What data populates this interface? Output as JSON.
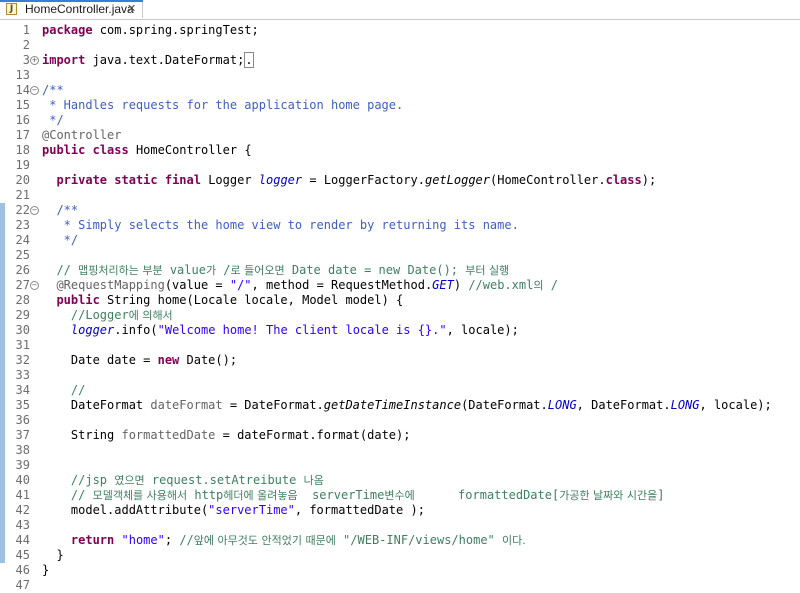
{
  "tab": {
    "filename": "HomeController.java",
    "close": "✕",
    "icon": "J"
  },
  "lines": [
    {
      "n": "1",
      "segs": [
        {
          "c": "kw",
          "t": "package"
        },
        {
          "c": "",
          "t": " com.spring.springTest;"
        }
      ]
    },
    {
      "n": "2",
      "segs": []
    },
    {
      "n": "3",
      "fold": "+",
      "segs": [
        {
          "c": "kw",
          "t": "import"
        },
        {
          "c": "",
          "t": " java.text.DateFormat;"
        },
        {
          "c": "box",
          "t": "."
        }
      ]
    },
    {
      "n": "13",
      "segs": []
    },
    {
      "n": "14",
      "fold": "-",
      "segs": [
        {
          "c": "jd",
          "t": "/**"
        }
      ]
    },
    {
      "n": "15",
      "segs": [
        {
          "c": "jd",
          "t": " * Handles requests for the application home page."
        }
      ]
    },
    {
      "n": "16",
      "segs": [
        {
          "c": "jd",
          "t": " */"
        }
      ]
    },
    {
      "n": "17",
      "segs": [
        {
          "c": "an",
          "t": "@Controller"
        }
      ]
    },
    {
      "n": "18",
      "segs": [
        {
          "c": "kw",
          "t": "public"
        },
        {
          "c": "",
          "t": " "
        },
        {
          "c": "kw",
          "t": "class"
        },
        {
          "c": "",
          "t": " HomeController {"
        }
      ]
    },
    {
      "n": "19",
      "segs": []
    },
    {
      "n": "20",
      "segs": [
        {
          "c": "",
          "t": "  "
        },
        {
          "c": "kw",
          "t": "private"
        },
        {
          "c": "",
          "t": " "
        },
        {
          "c": "kw",
          "t": "static"
        },
        {
          "c": "",
          "t": " "
        },
        {
          "c": "kw",
          "t": "final"
        },
        {
          "c": "",
          "t": " Logger "
        },
        {
          "c": "fi",
          "t": "logger"
        },
        {
          "c": "",
          "t": " = LoggerFactory."
        },
        {
          "c": "it",
          "t": "getLogger"
        },
        {
          "c": "",
          "t": "(HomeController."
        },
        {
          "c": "kw",
          "t": "class"
        },
        {
          "c": "",
          "t": ");"
        }
      ]
    },
    {
      "n": "21",
      "segs": []
    },
    {
      "n": "22",
      "fold": "-",
      "chg": true,
      "segs": [
        {
          "c": "",
          "t": "  "
        },
        {
          "c": "jd",
          "t": "/**"
        }
      ]
    },
    {
      "n": "23",
      "chg": true,
      "segs": [
        {
          "c": "jd",
          "t": "   * Simply selects the home view to render by returning its name."
        }
      ]
    },
    {
      "n": "24",
      "chg": true,
      "segs": [
        {
          "c": "jd",
          "t": "   */"
        }
      ]
    },
    {
      "n": "25",
      "chg": true,
      "segs": []
    },
    {
      "n": "26",
      "chg": true,
      "segs": [
        {
          "c": "cm",
          "t": "  // "
        },
        {
          "c": "cm kr",
          "t": "맵핑처리하는 부분"
        },
        {
          "c": "cm",
          "t": " value"
        },
        {
          "c": "cm kr",
          "t": "가"
        },
        {
          "c": "cm",
          "t": " /"
        },
        {
          "c": "cm kr",
          "t": "로 들어오면"
        },
        {
          "c": "cm",
          "t": " Date date = new Date(); "
        },
        {
          "c": "cm kr",
          "t": "부터 실행"
        }
      ]
    },
    {
      "n": "27",
      "fold": "-",
      "chg": true,
      "segs": [
        {
          "c": "",
          "t": "  "
        },
        {
          "c": "an",
          "t": "@RequestMapping"
        },
        {
          "c": "",
          "t": "(value = "
        },
        {
          "c": "st",
          "t": "\"/\""
        },
        {
          "c": "",
          "t": ", method = RequestMethod."
        },
        {
          "c": "fi",
          "t": "GET"
        },
        {
          "c": "",
          "t": ") "
        },
        {
          "c": "cm",
          "t": "//web.xml"
        },
        {
          "c": "cm kr",
          "t": "의"
        },
        {
          "c": "cm",
          "t": " /"
        }
      ]
    },
    {
      "n": "28",
      "chg": true,
      "segs": [
        {
          "c": "",
          "t": "  "
        },
        {
          "c": "kw",
          "t": "public"
        },
        {
          "c": "",
          "t": " String home(Locale locale, Model model) {"
        }
      ]
    },
    {
      "n": "29",
      "chg": true,
      "segs": [
        {
          "c": "cm",
          "t": "    //Logger"
        },
        {
          "c": "cm kr",
          "t": "에 의해서"
        }
      ]
    },
    {
      "n": "30",
      "chg": true,
      "segs": [
        {
          "c": "",
          "t": "    "
        },
        {
          "c": "fi",
          "t": "logger"
        },
        {
          "c": "",
          "t": ".info("
        },
        {
          "c": "st",
          "t": "\"Welcome home! The client locale is {}.\""
        },
        {
          "c": "",
          "t": ", locale);"
        }
      ]
    },
    {
      "n": "31",
      "chg": true,
      "segs": []
    },
    {
      "n": "32",
      "chg": true,
      "segs": [
        {
          "c": "",
          "t": "    Date date = "
        },
        {
          "c": "kw",
          "t": "new"
        },
        {
          "c": "",
          "t": " Date();"
        }
      ]
    },
    {
      "n": "33",
      "chg": true,
      "segs": []
    },
    {
      "n": "34",
      "chg": true,
      "segs": [
        {
          "c": "cm",
          "t": "    //"
        }
      ]
    },
    {
      "n": "35",
      "chg": true,
      "segs": [
        {
          "c": "",
          "t": "    DateFormat "
        },
        {
          "c": "an",
          "t": "dateFormat"
        },
        {
          "c": "",
          "t": " = DateFormat."
        },
        {
          "c": "it",
          "t": "getDateTimeInstance"
        },
        {
          "c": "",
          "t": "(DateFormat."
        },
        {
          "c": "fi",
          "t": "LONG"
        },
        {
          "c": "",
          "t": ", DateFormat."
        },
        {
          "c": "fi",
          "t": "LONG"
        },
        {
          "c": "",
          "t": ", locale);"
        }
      ]
    },
    {
      "n": "36",
      "chg": true,
      "segs": []
    },
    {
      "n": "37",
      "chg": true,
      "segs": [
        {
          "c": "",
          "t": "    String "
        },
        {
          "c": "an",
          "t": "formattedDate"
        },
        {
          "c": "",
          "t": " = dateFormat.format(date);"
        }
      ]
    },
    {
      "n": "38",
      "chg": true,
      "segs": []
    },
    {
      "n": "39",
      "chg": true,
      "segs": []
    },
    {
      "n": "40",
      "chg": true,
      "segs": [
        {
          "c": "cm",
          "t": "    //jsp "
        },
        {
          "c": "cm kr",
          "t": "였으면"
        },
        {
          "c": "cm",
          "t": " request.setAtreibute "
        },
        {
          "c": "cm kr",
          "t": "나옴"
        }
      ]
    },
    {
      "n": "41",
      "chg": true,
      "segs": [
        {
          "c": "cm",
          "t": "    // "
        },
        {
          "c": "cm kr",
          "t": "모델객체를 사용해서"
        },
        {
          "c": "cm",
          "t": " http"
        },
        {
          "c": "cm kr",
          "t": "헤더에 올려놓음"
        },
        {
          "c": "cm",
          "t": "  serverTime"
        },
        {
          "c": "cm kr",
          "t": "변수에"
        },
        {
          "c": "cm",
          "t": "      formattedDate["
        },
        {
          "c": "cm kr",
          "t": "가공한 날짜와 시간을"
        },
        {
          "c": "cm",
          "t": "]"
        }
      ]
    },
    {
      "n": "42",
      "chg": true,
      "segs": [
        {
          "c": "",
          "t": "    model.addAttribute("
        },
        {
          "c": "st",
          "t": "\"serverTime\""
        },
        {
          "c": "",
          "t": ", formattedDate );"
        }
      ]
    },
    {
      "n": "43",
      "chg": true,
      "segs": []
    },
    {
      "n": "44",
      "chg": true,
      "segs": [
        {
          "c": "",
          "t": "    "
        },
        {
          "c": "kw",
          "t": "return"
        },
        {
          "c": "",
          "t": " "
        },
        {
          "c": "st",
          "t": "\"home\""
        },
        {
          "c": "",
          "t": "; "
        },
        {
          "c": "cm",
          "t": "//"
        },
        {
          "c": "cm kr",
          "t": "앞에 아무것도 안적었기 때문에"
        },
        {
          "c": "cm",
          "t": " \"/WEB-INF/views/home\" "
        },
        {
          "c": "cm kr",
          "t": "이다."
        }
      ]
    },
    {
      "n": "45",
      "chg": true,
      "segs": [
        {
          "c": "",
          "t": "  }"
        }
      ]
    },
    {
      "n": "46",
      "segs": [
        {
          "c": "",
          "t": "}"
        }
      ]
    },
    {
      "n": "47",
      "segs": []
    }
  ]
}
